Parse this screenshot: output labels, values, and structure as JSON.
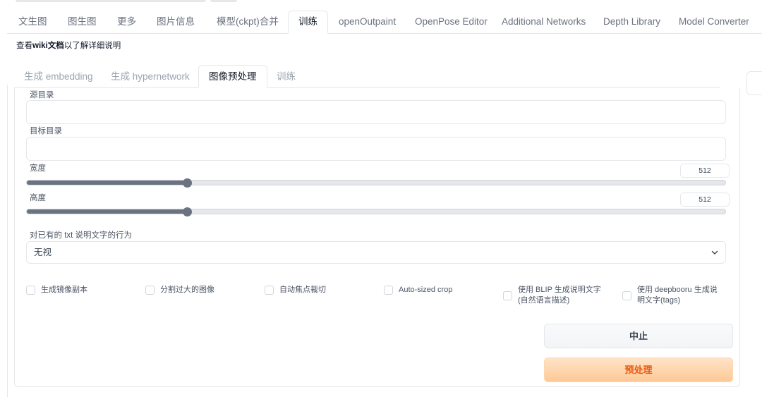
{
  "main_tabs": [
    "文生图",
    "图生图",
    "更多",
    "图片信息",
    "模型(ckpt)合并",
    "训练",
    "openOutpaint",
    "OpenPose Editor",
    "Additional Networks",
    "Depth Library",
    "Model Converter"
  ],
  "main_tabs_active": "训练",
  "wiki": {
    "pre": "查看",
    "bold": "wiki文档",
    "post": "以了解详细说明"
  },
  "sub_tabs": [
    "生成 embedding",
    "生成 hypernetwork",
    "图像预处理",
    "训练"
  ],
  "sub_tabs_active": "图像预处理",
  "form": {
    "source_dir_label": "源目录",
    "source_dir_value": "",
    "target_dir_label": "目标目录",
    "target_dir_value": "",
    "width_label": "宽度",
    "width_value": "512",
    "width_slider_fraction": 0.23,
    "height_label": "高度",
    "height_value": "512",
    "height_slider_fraction": 0.23,
    "caption_behavior_label": "对已有的 txt 说明文字的行为",
    "caption_behavior_value": "无视",
    "checkboxes": [
      {
        "label": "生成镜像副本",
        "checked": false
      },
      {
        "label": "分割过大的图像",
        "checked": false
      },
      {
        "label": "自动焦点裁切",
        "checked": false
      },
      {
        "label": "Auto-sized crop",
        "checked": false
      },
      {
        "label": "使用 BLIP 生成说明文字\n(自然语言描述)",
        "checked": false
      },
      {
        "label": "使用 deepbooru 生成说\n明文字(tags)",
        "checked": false
      }
    ]
  },
  "buttons": {
    "stop": "中止",
    "preprocess": "预处理"
  },
  "colors": {
    "accent": "#ea580c",
    "accent_bg": "#fdc996",
    "slider": "#6b7280"
  },
  "icons": {
    "dropdown": "chevron-down-icon"
  }
}
